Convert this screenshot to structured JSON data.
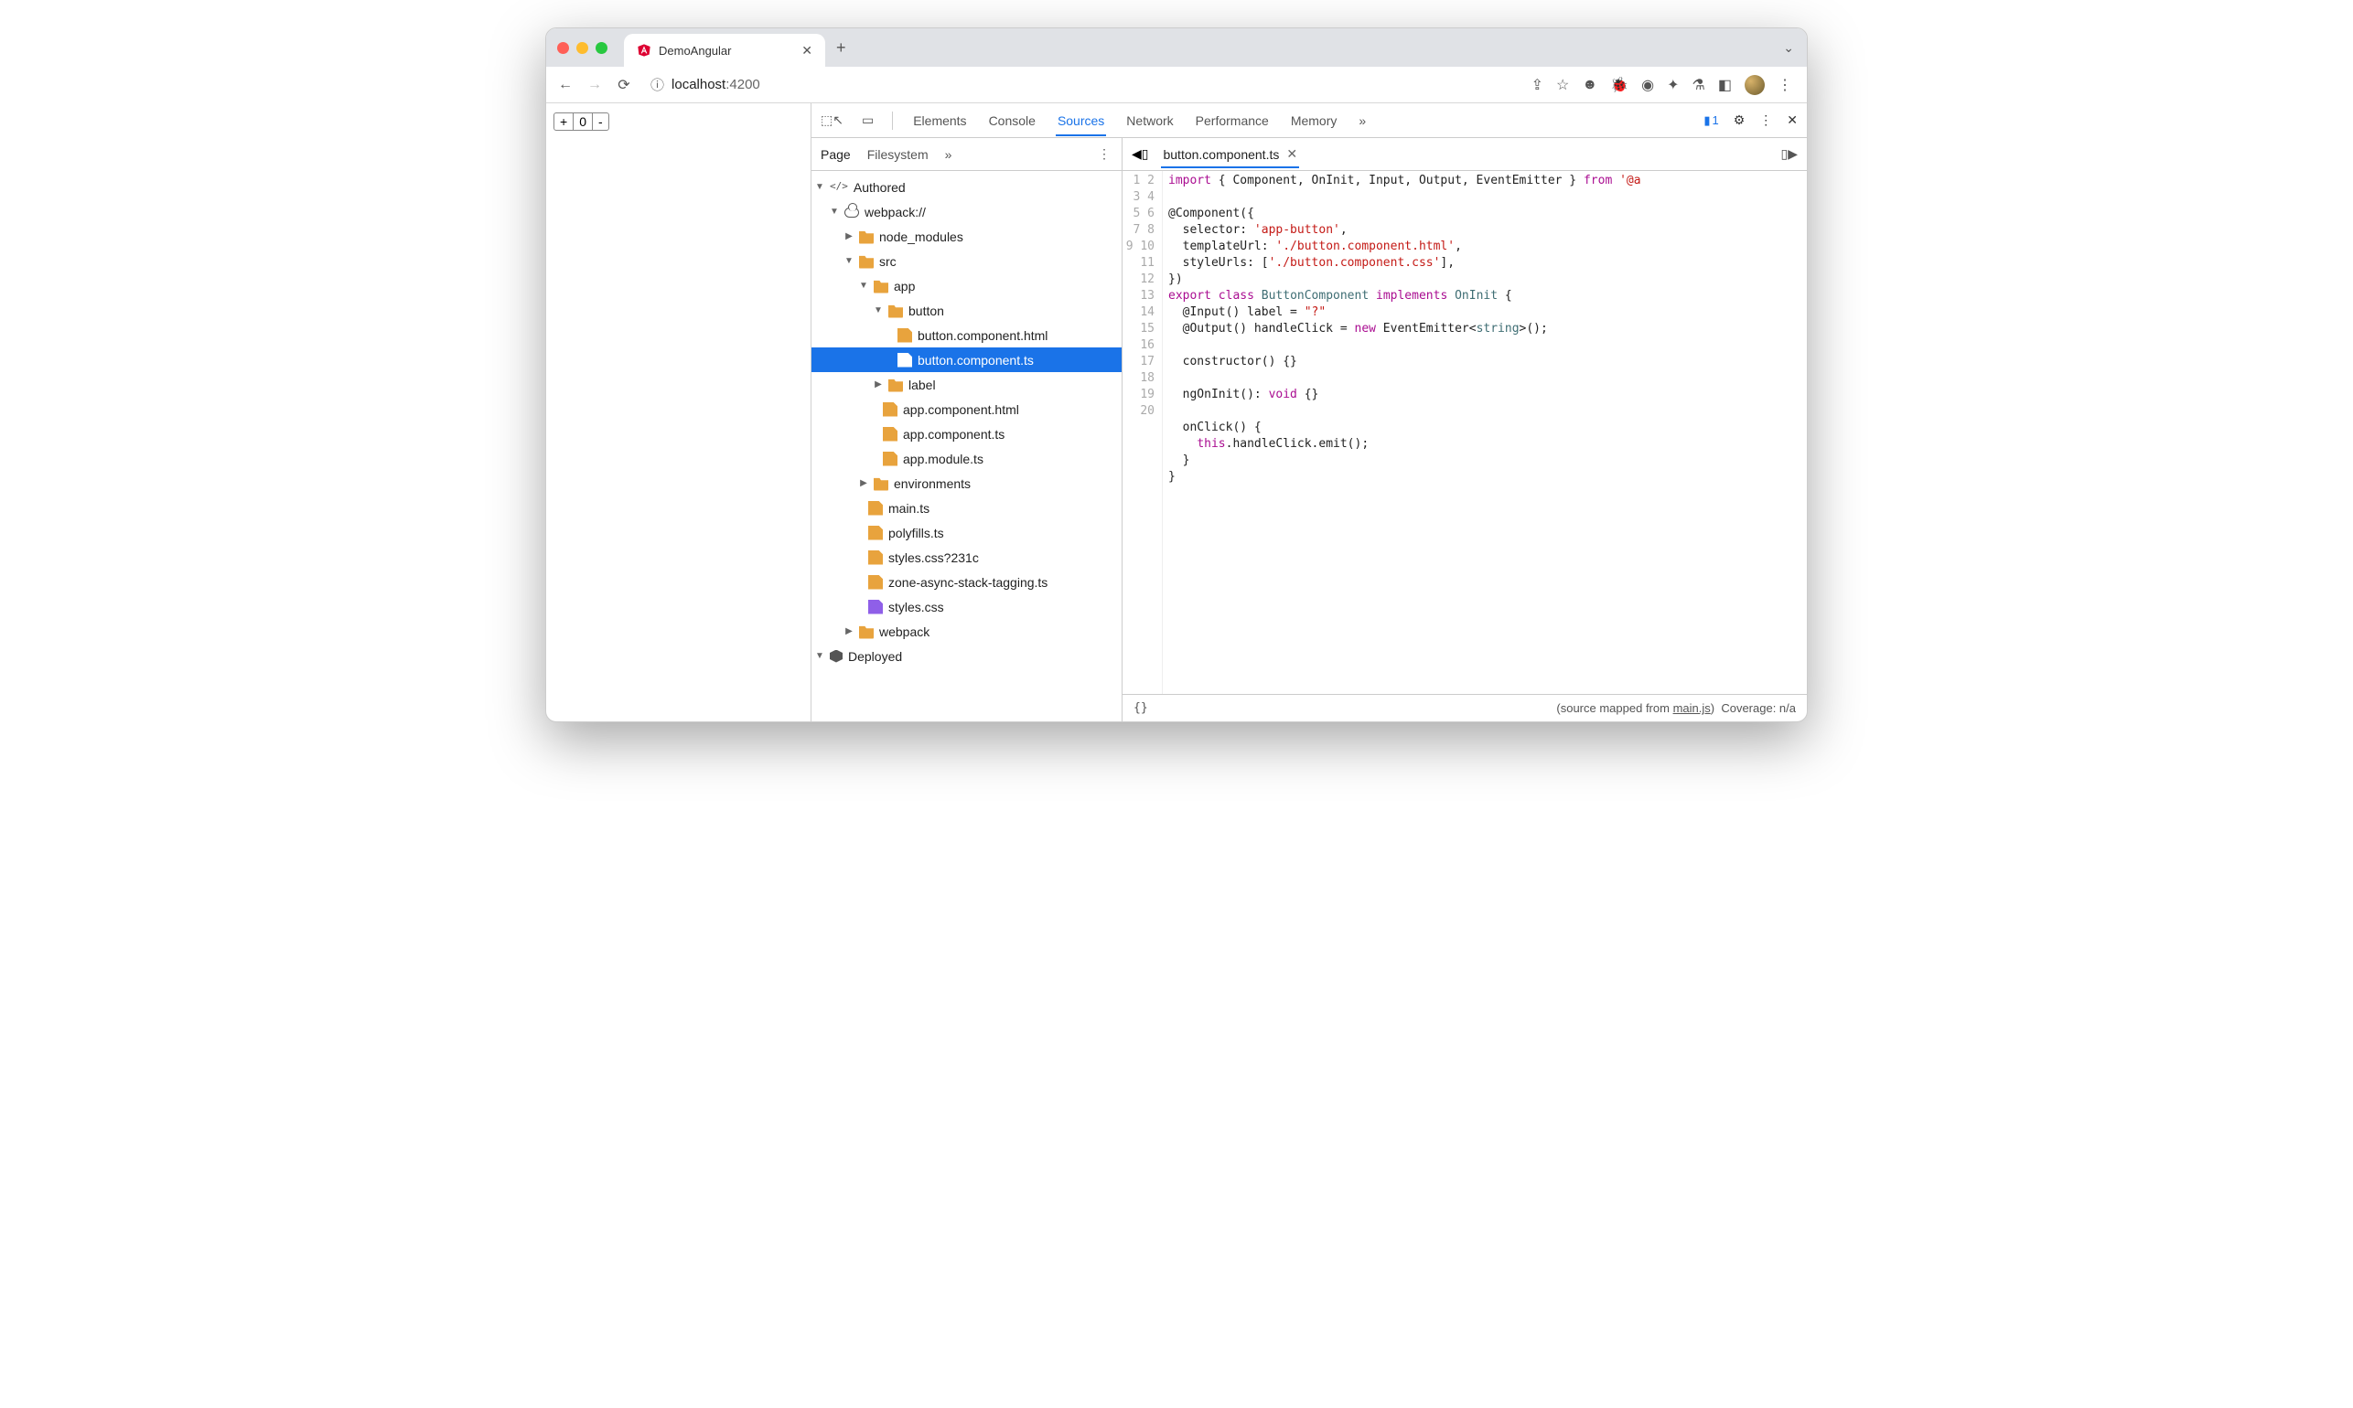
{
  "browser": {
    "tab_title": "DemoAngular",
    "url_host": "localhost",
    "url_port": ":4200"
  },
  "page_counter": {
    "plus": "+",
    "value": "0",
    "minus": "-"
  },
  "devtools": {
    "panels": [
      "Elements",
      "Console",
      "Sources",
      "Network",
      "Performance",
      "Memory"
    ],
    "active_panel": "Sources",
    "overflow": "»",
    "msg_count": "1"
  },
  "sources": {
    "left_tabs": [
      "Page",
      "Filesystem"
    ],
    "left_active": "Page",
    "overflow": "»",
    "tree": {
      "authored": "Authored",
      "webpack": "webpack://",
      "node_modules": "node_modules",
      "src": "src",
      "app": "app",
      "button": "button",
      "button_html": "button.component.html",
      "button_ts": "button.component.ts",
      "label": "label",
      "app_html": "app.component.html",
      "app_ts": "app.component.ts",
      "app_module": "app.module.ts",
      "environments": "environments",
      "main": "main.ts",
      "polyfills": "polyfills.ts",
      "styles_q": "styles.css?231c",
      "zone": "zone-async-stack-tagging.ts",
      "styles": "styles.css",
      "webpack_folder": "webpack",
      "deployed": "Deployed"
    }
  },
  "editor": {
    "tab": "button.component.ts",
    "lines": [
      1,
      2,
      3,
      4,
      5,
      6,
      7,
      8,
      9,
      10,
      11,
      12,
      13,
      14,
      15,
      16,
      17,
      18,
      19,
      20
    ],
    "code": {
      "l1_a": "import",
      "l1_b": " { Component, OnInit, Input, Output, EventEmitter } ",
      "l1_c": "from",
      "l1_d": " '@a",
      "l3": "@Component({",
      "l4_a": "  selector: ",
      "l4_b": "'app-button'",
      "l4_c": ",",
      "l5_a": "  templateUrl: ",
      "l5_b": "'./button.component.html'",
      "l5_c": ",",
      "l6_a": "  styleUrls: [",
      "l6_b": "'./button.component.css'",
      "l6_c": "],",
      "l7": "})",
      "l8_a": "export",
      "l8_b": " class ",
      "l8_c": "ButtonComponent",
      "l8_d": " implements ",
      "l8_e": "OnInit",
      "l8_f": " {",
      "l9_a": "  @Input() label = ",
      "l9_b": "\"?\"",
      "l10_a": "  @Output() handleClick = ",
      "l10_b": "new",
      "l10_c": " EventEmitter<",
      "l10_d": "string",
      "l10_e": ">();",
      "l12": "  constructor() {}",
      "l14_a": "  ngOnInit(): ",
      "l14_b": "void",
      "l14_c": " {}",
      "l16": "  onClick() {",
      "l17_a": "    ",
      "l17_b": "this",
      "l17_c": ".handleClick.emit();",
      "l18": "  }",
      "l19": "}"
    }
  },
  "status": {
    "braces": "{}",
    "mapped_a": "(source mapped from ",
    "mapped_b": "main.js",
    "mapped_c": ")",
    "coverage": "Coverage: n/a"
  }
}
